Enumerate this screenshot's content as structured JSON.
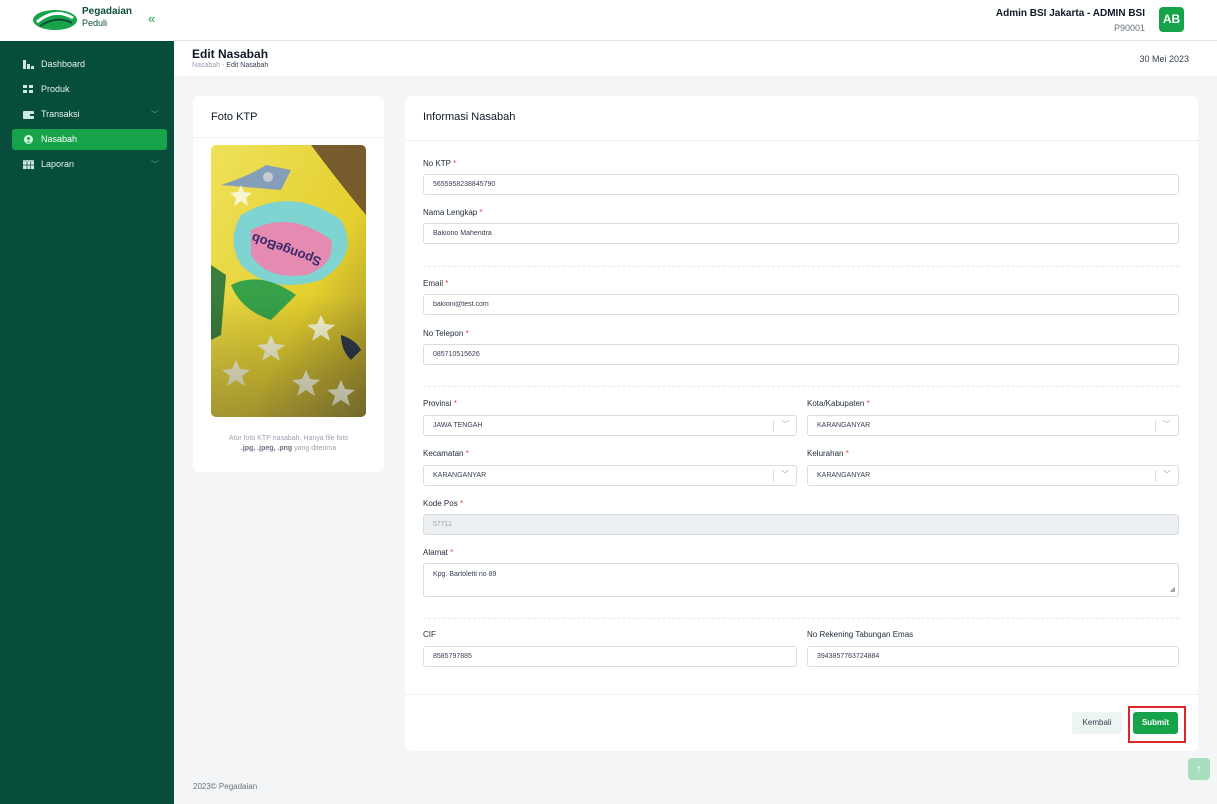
{
  "app": {
    "brand_name": "Pegadaian",
    "brand_sub": "Peduli",
    "collapse_icon": "double-chevron-left-icon"
  },
  "user": {
    "name": "Admin BSI Jakarta - ADMIN BSI",
    "id": "P90001",
    "initials": "AB"
  },
  "sidebar": {
    "items": [
      {
        "label": "Dashboard",
        "icon": "chart-bar-icon"
      },
      {
        "label": "Produk",
        "icon": "grid-icon"
      },
      {
        "label": "Transaksi",
        "icon": "wallet-icon",
        "chevron": "﹀"
      },
      {
        "label": "Nasabah",
        "icon": "user-circle-icon",
        "active": true
      },
      {
        "label": "Laporan",
        "icon": "calendar-table-icon",
        "chevron": "﹀"
      }
    ]
  },
  "page": {
    "title": "Edit Nasabah",
    "breadcrumb": {
      "parent": "Nasabah",
      "sep": "-",
      "current": "Edit Nasabah"
    },
    "date": "30 Mei 2023"
  },
  "ktp_card": {
    "title": "Foto KTP",
    "note_1": "Atur foto KTP nasabah. Hanya file foto",
    "note_2": ".jpg, .jpeg, .png",
    "note_3": "yang diterima"
  },
  "form": {
    "title": "Informasi Nasabah",
    "required_mark": "*",
    "no_ktp": {
      "label": "No KTP",
      "value": "5655958238845790"
    },
    "nama": {
      "label": "Nama Lengkap",
      "value": "Bakiono Mahendra"
    },
    "email": {
      "label": "Email",
      "value": "bakioni@test.com"
    },
    "telepon": {
      "label": "No Telepon",
      "value": "085710515626"
    },
    "provinsi": {
      "label": "Provinsi",
      "value": "JAWA TENGAH"
    },
    "kota": {
      "label": "Kota/Kabupaten",
      "value": "KARANGANYAR"
    },
    "kecamatan": {
      "label": "Kecamatan",
      "value": "KARANGANYAR"
    },
    "kelurahan": {
      "label": "Kelurahan",
      "value": "KARANGANYAR"
    },
    "kode_pos": {
      "label": "Kode Pos",
      "value": "57711"
    },
    "alamat": {
      "label": "Alamat",
      "value": "Kpg. Bartoletti no 89"
    },
    "cif": {
      "label": "CIF",
      "value": "8585797885"
    },
    "rekening": {
      "label": "No Rekening Tabungan Emas",
      "value": "3943857763724884"
    },
    "select_chevron": "﹀",
    "back_label": "Kembali",
    "submit_label": "Submit"
  },
  "footer": {
    "text": "2023© Pegadaian"
  },
  "colors": {
    "sidebar": "#064e3b",
    "accent": "#16a34a",
    "highlight": "#dc2626"
  }
}
